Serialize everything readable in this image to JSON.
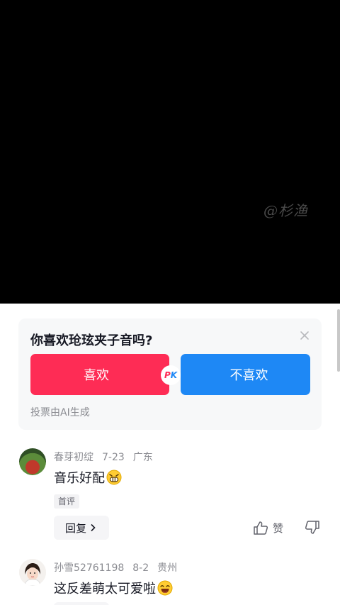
{
  "video": {
    "watermark": "@杉渔"
  },
  "poll": {
    "question": "你喜欢玱玹夹子音吗?",
    "option_like": "喜欢",
    "option_dislike": "不喜欢",
    "pk_p": "P",
    "pk_k": "K",
    "note": "投票由AI生成"
  },
  "comments": [
    {
      "username": "春芽初绽",
      "date": "7-23",
      "location": "广东",
      "text": "音乐好配",
      "emoji": "grinning-emoji",
      "tag": "首评",
      "reply_label": "回复",
      "like_label": "赞"
    },
    {
      "username": "孙雪52761198",
      "date": "8-2",
      "location": "贵州",
      "text": "这反差萌太可爱啦",
      "emoji": "laughing-emoji"
    }
  ],
  "colors": {
    "like": "#fe2c55",
    "dislike": "#1e88f5",
    "muted": "#8a8b91"
  }
}
